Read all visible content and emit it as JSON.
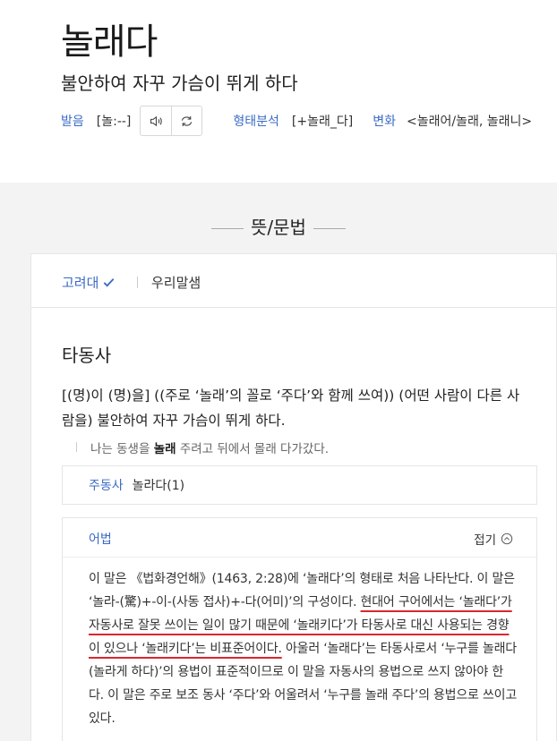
{
  "entry": {
    "headword": "놀래다",
    "summary": "불안하여 자꾸 가슴이 뛰게 하다"
  },
  "meta": {
    "pron_label": "발음",
    "pron_value": "[놀:--]",
    "morph_label": "형태분석",
    "morph_value": "[+놀래_다]",
    "conj_label": "변화",
    "conj_value": "<놀래어/놀래, 놀래니>"
  },
  "section": {
    "title": "뜻/문법"
  },
  "tabs": [
    {
      "label": "고려대"
    },
    {
      "label": "우리말샘"
    }
  ],
  "sense": {
    "pos": "타동사",
    "definition": "[(명)이 (명)을] ((주로 ‘놀래’의 꼴로 ‘주다’와 함께 쓰여)) (어떤 사람이 다른 사람을) 불안하여 자꾸 가슴이 뛰게 하다.",
    "example_before": "나는 동생을 ",
    "example_bold": "놀래",
    "example_after": " 주려고 뒤에서 몰래 다가갔다."
  },
  "active_verb": {
    "label": "주동사",
    "value": "놀라다(1)"
  },
  "usage": {
    "label": "어법",
    "fold_label": "접기",
    "text_a": "이 말은 《법화경언해》(1463, 2:28)에 ‘놀래다’의 형태로 처음 나타난다. 이 말은 ‘놀라-(驚)+-이-(사동 접사)+-다(어미)’의 구성이다. ",
    "text_b": "현대어 구어에서는 ‘놀래다’가 자동사로 잘못 쓰이는 일이 많기 때문에 ‘놀래키다’가 타동사로 대신 사용되는 경향이 있으나 ‘놀래키다’는 비표준어이다.",
    "text_c": " 아울러 ‘놀래다’는 타동사로서 ‘누구를 놀래다(놀라게 하다)’의 용법이 표준적이므로 이 말을 자동사의 용법으로 쓰지 않아야 한다. 이 말은 주로 보조 동사 ‘주다’와 어울려서 ‘누구를 놀래 주다’의 용법으로 쓰이고 있다."
  },
  "colors": {
    "accent": "#3b6bc4",
    "underline": "#d9272e",
    "section_bg": "#f3f3f4"
  }
}
